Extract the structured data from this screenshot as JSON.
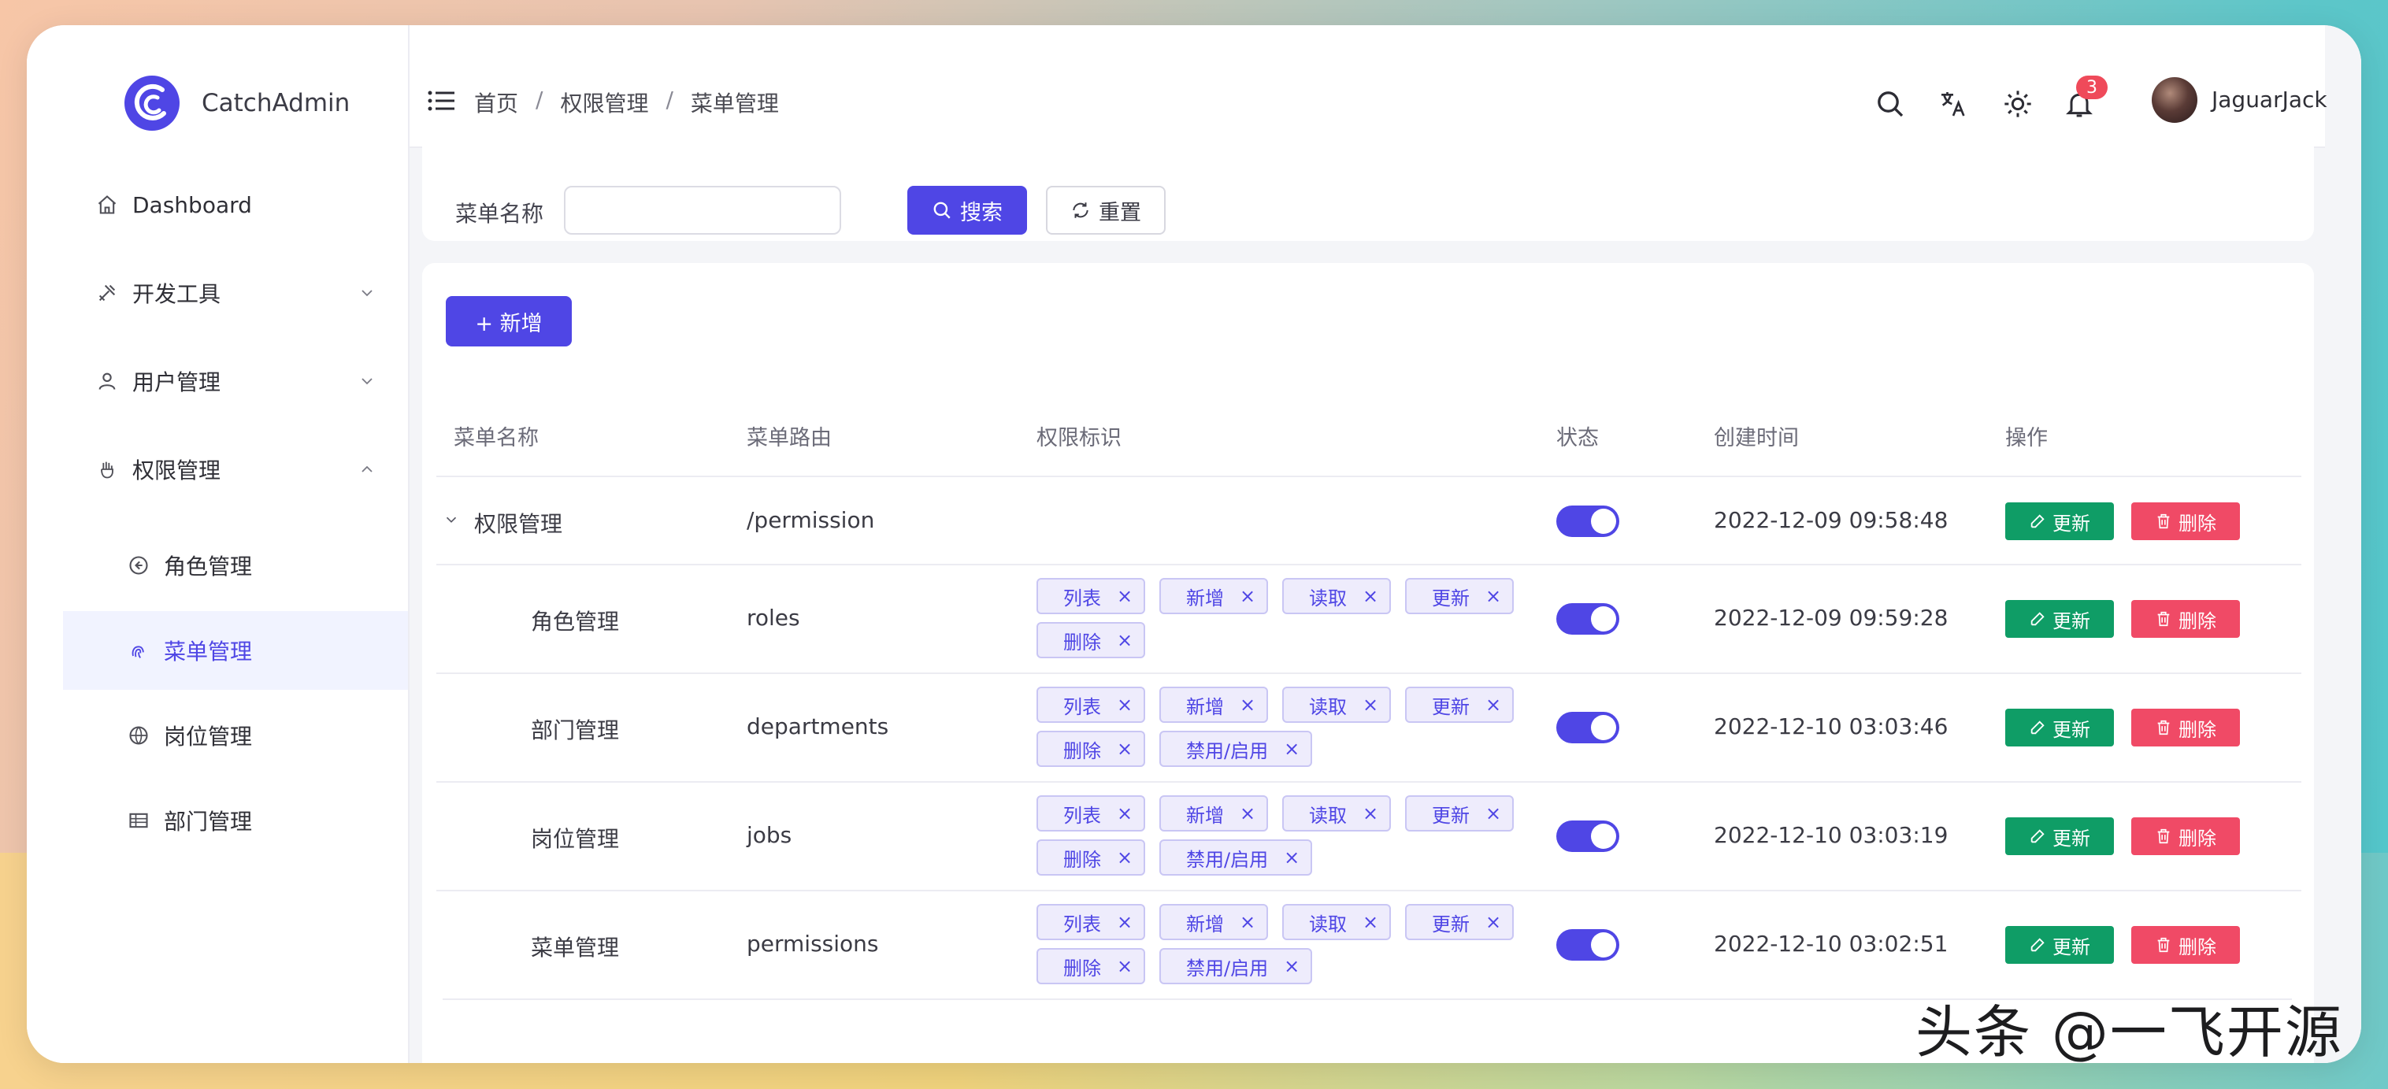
{
  "brand": {
    "name": "CatchAdmin"
  },
  "sidebar": {
    "items": [
      {
        "label": "Dashboard"
      },
      {
        "label": "开发工具"
      },
      {
        "label": "用户管理"
      },
      {
        "label": "权限管理"
      }
    ],
    "subitems": [
      {
        "label": "角色管理"
      },
      {
        "label": "菜单管理"
      },
      {
        "label": "岗位管理"
      },
      {
        "label": "部门管理"
      }
    ]
  },
  "header": {
    "breadcrumb": [
      "首页",
      "权限管理",
      "菜单管理"
    ],
    "separator": "/",
    "notifications": "3",
    "username": "JaguarJack"
  },
  "search": {
    "label": "菜单名称",
    "value": "",
    "search_btn": "搜索",
    "reset_btn": "重置"
  },
  "toolbar": {
    "add_btn": "+ 新增"
  },
  "table": {
    "columns": [
      "菜单名称",
      "菜单路由",
      "权限标识",
      "状态",
      "创建时间",
      "操作"
    ],
    "update_label": "更新",
    "delete_label": "删除",
    "rows": [
      {
        "name": "权限管理",
        "route": "/permission",
        "tags": [],
        "enabled": true,
        "created": "2022-12-09 09:58:48"
      },
      {
        "name": "角色管理",
        "route": "roles",
        "tags": [
          "列表",
          "新增",
          "读取",
          "更新",
          "删除"
        ],
        "enabled": true,
        "created": "2022-12-09 09:59:28"
      },
      {
        "name": "部门管理",
        "route": "departments",
        "tags": [
          "列表",
          "新增",
          "读取",
          "更新",
          "删除",
          "禁用/启用"
        ],
        "enabled": true,
        "created": "2022-12-10 03:03:46"
      },
      {
        "name": "岗位管理",
        "route": "jobs",
        "tags": [
          "列表",
          "新增",
          "读取",
          "更新",
          "删除",
          "禁用/启用"
        ],
        "enabled": true,
        "created": "2022-12-10 03:03:19"
      },
      {
        "name": "菜单管理",
        "route": "permissions",
        "tags": [
          "列表",
          "新增",
          "读取",
          "更新",
          "删除",
          "禁用/启用"
        ],
        "enabled": true,
        "created": "2022-12-10 03:02:51"
      }
    ]
  },
  "watermark": "头条 @一飞开源",
  "colors": {
    "accent": "#4f46e5",
    "success": "#0f9d66",
    "danger": "#f04a66"
  }
}
